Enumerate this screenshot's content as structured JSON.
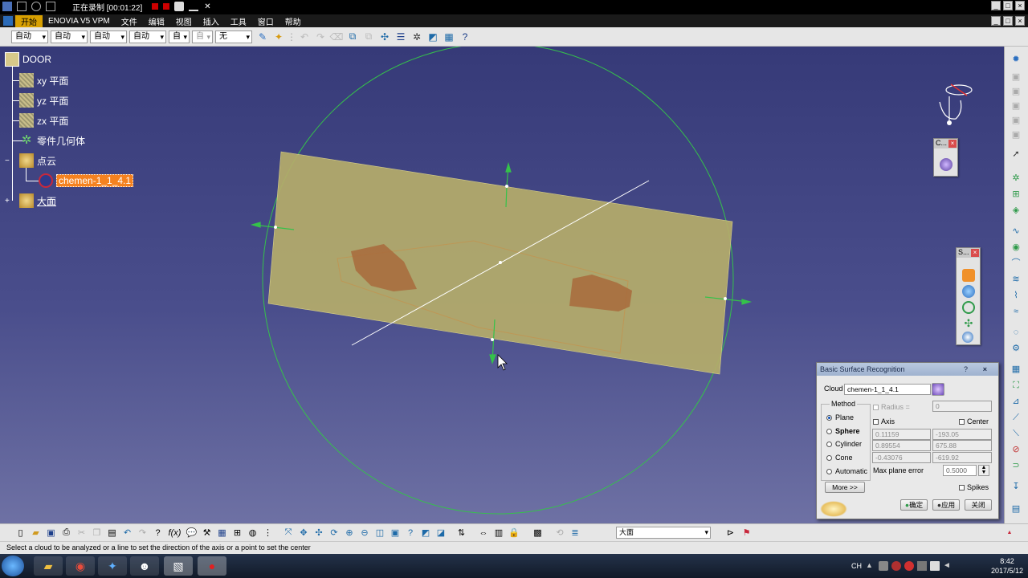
{
  "recorder": {
    "status_label": "正在录制 [00:01:22]"
  },
  "menu": {
    "items": [
      "开始",
      "ENOVIA V5 VPM",
      "文件",
      "编辑",
      "视图",
      "插入",
      "工具",
      "窗口",
      "帮助"
    ],
    "active_index": 0
  },
  "toolbar": {
    "selects": [
      "自动",
      "自动",
      "自动",
      "自动",
      "自",
      "自",
      "无"
    ]
  },
  "tree": {
    "root": "DOOR",
    "nodes": [
      {
        "label": "xy 平面",
        "icon": "plane-icon"
      },
      {
        "label": "yz 平面",
        "icon": "plane-icon"
      },
      {
        "label": "zx 平面",
        "icon": "plane-icon"
      },
      {
        "label": "零件几何体",
        "icon": "part-body-icon"
      },
      {
        "label": "点云",
        "icon": "point-cloud-icon"
      },
      {
        "label": "chemen-1_1_4.1",
        "icon": "cloud-icon"
      },
      {
        "label": "大面",
        "icon": "surface-set-icon"
      }
    ]
  },
  "mini_toolbars": {
    "compass_toolbar_title": "C...",
    "side_toolbar_title": "S..."
  },
  "dialog": {
    "title": "Basic Surface Recognition",
    "help_symbol": "?",
    "close_symbol": "×",
    "cloud_label": "Cloud",
    "cloud_value": "chemen-1_1_4.1",
    "method_label": "Method",
    "methods": [
      "Plane",
      "Sphere",
      "Cylinder",
      "Cone",
      "Automatic"
    ],
    "selected_method": "Plane",
    "radius_label": "Radius =",
    "radius_value": "0",
    "axis_label": "Axis",
    "center_label": "Center",
    "axis_values": [
      "0.11159",
      "0.89554",
      "-0.43076"
    ],
    "center_values": [
      "-193.05",
      "675.88",
      "-619.92"
    ],
    "max_error_label": "Max plane error",
    "max_error_value": "0.5000",
    "more_button": "More >>",
    "spikes_label": "Spikes",
    "ok_button": "确定",
    "apply_button": "应用",
    "close_button": "关闭"
  },
  "bottom_toolbar": {
    "select_value": "大面"
  },
  "status": {
    "message": "Select a cloud to be analyzed or a line to set the direction of the axis or a point to set the center"
  },
  "taskbar": {
    "time": "8:42",
    "date": "2017/5/12",
    "language": "CH"
  },
  "colors": {
    "viewport_top": "#363a78",
    "plane_fill": "#b5ad6a",
    "cloud_patch": "#a86a3c",
    "circle_green": "#35c24a",
    "selection_orange": "#f58220",
    "catia_red": "#c8283c"
  }
}
